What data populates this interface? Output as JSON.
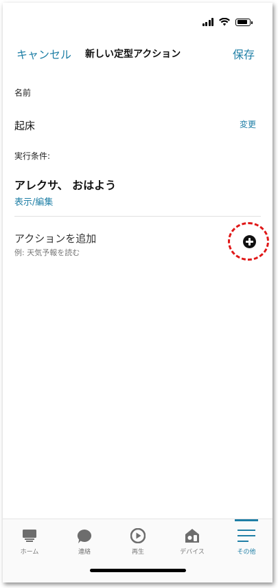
{
  "header": {
    "cancel_label": "キャンセル",
    "title": "新しい定型アクション",
    "save_label": "保存"
  },
  "name_section": {
    "label": "名前",
    "value": "起床",
    "change_label": "変更"
  },
  "trigger_section": {
    "label": "実行条件:",
    "phrase": "アレクサ、 おはよう",
    "view_edit_label": "表示/編集"
  },
  "action_section": {
    "label": "アクションを追加",
    "hint": "例: 天気予報を読む",
    "add_icon": "plus-circle-icon",
    "highlight_color": "#e01818"
  },
  "tabbar": {
    "items": [
      {
        "label": "ホーム",
        "icon": "home-icon"
      },
      {
        "label": "連絡",
        "icon": "chat-bubble-icon"
      },
      {
        "label": "再生",
        "icon": "play-icon"
      },
      {
        "label": "デバイス",
        "icon": "devices-icon"
      },
      {
        "label": "その他",
        "icon": "menu-icon",
        "active": true
      }
    ]
  },
  "colors": {
    "accent": "#1f7fa6",
    "text": "#111111"
  }
}
